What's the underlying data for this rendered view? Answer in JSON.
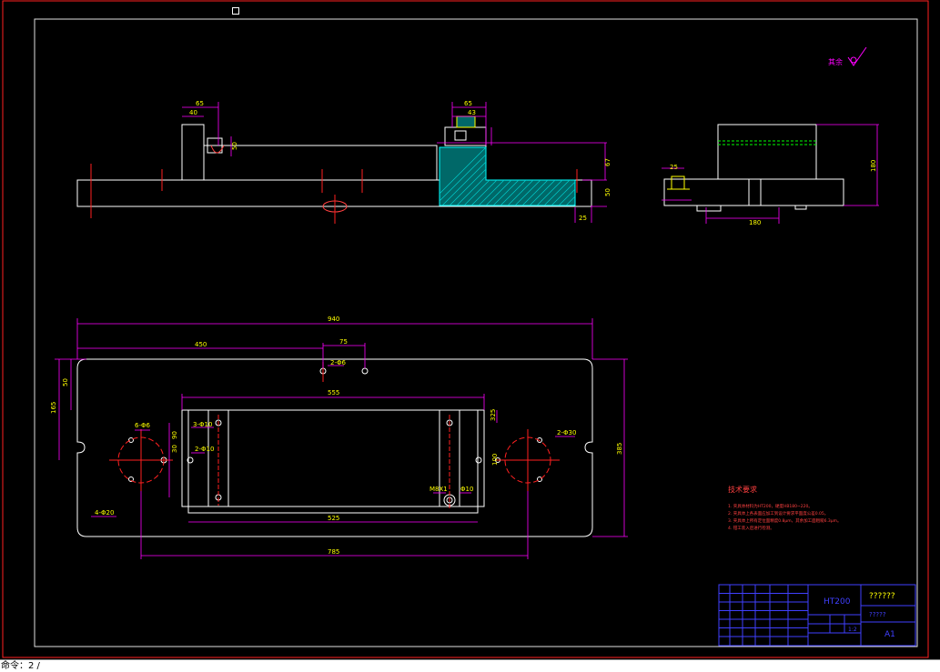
{
  "drawing": {
    "roughness_symbol_label": "其余",
    "tech_requirements": {
      "title": "技术要求",
      "items": [
        "1. 夹具体材料为HT200，硬度HB180~220。",
        "2. 夹具体上各表面应加工到设计要求平面度公差0.05。",
        "3. 夹具体上所有定位面精度0.8μm，其余加工面粗糙6.3μm。",
        "4. 钳工装入后进行检测。"
      ]
    },
    "dims_front": [
      "65",
      "40",
      "65",
      "43",
      "50",
      "67",
      "50",
      "25"
    ],
    "dims_side": [
      "25",
      "180",
      "180"
    ],
    "dims_plan": [
      "940",
      "450",
      "75",
      "2-Φ6",
      "555",
      "50",
      "165",
      "3-Φ10",
      "2-Φ10",
      "30",
      "90",
      "6-Φ6",
      "2-Φ30",
      "100",
      "M8X1",
      "Φ10",
      "325",
      "385",
      "525",
      "4-Φ20",
      "785"
    ],
    "title_block": {
      "material": "HT200",
      "drawing_name": "??????",
      "code": "?????",
      "sheet_size": "A1",
      "scale": "1:2"
    }
  },
  "status_bar": {
    "text": "命令：2 /"
  }
}
